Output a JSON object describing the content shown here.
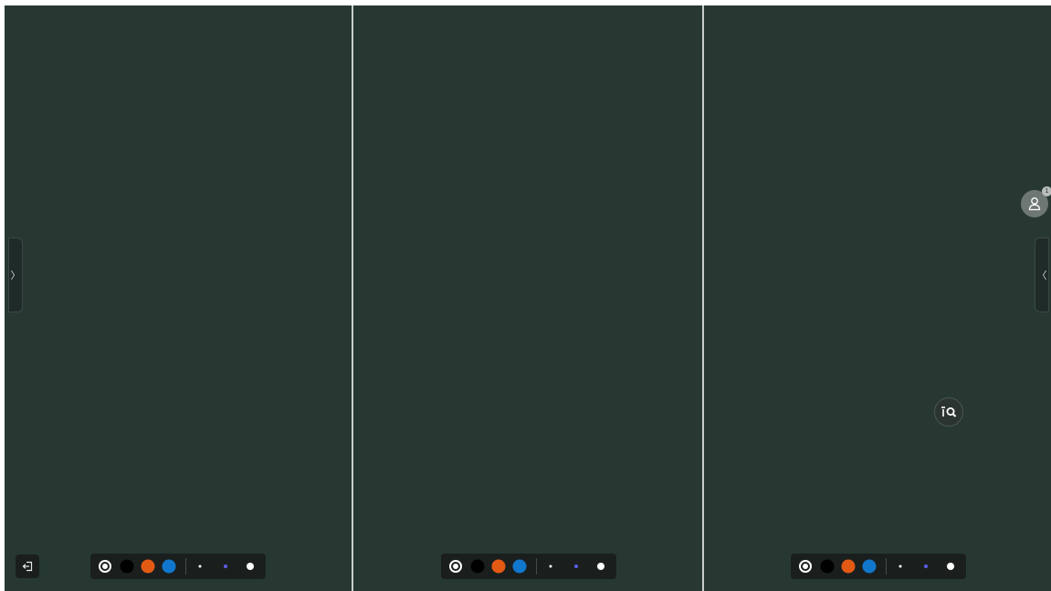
{
  "panels": [
    {
      "name": "left"
    },
    {
      "name": "middle"
    },
    {
      "name": "right"
    }
  ],
  "side_tabs": {
    "left_icon": "chevron-right-icon",
    "left_glyph": "〉",
    "right_icon": "chevron-left-icon",
    "right_glyph": "〈"
  },
  "toolbar": {
    "pen_icon": "pen-tool-icon",
    "colors": [
      "#000000",
      "#e35a14",
      "#1177cc"
    ],
    "sizes": [
      "small",
      "medium",
      "large"
    ],
    "medium_dot_color": "#5b5ee8"
  },
  "exit_button": {
    "icon": "exit-icon"
  },
  "participants": {
    "icon": "user-icon",
    "count": "1"
  },
  "zoom_button": {
    "icon": "zoom-search-icon"
  },
  "theme": {
    "board_color": "#273833",
    "divider_color": "#c9cdcb"
  }
}
